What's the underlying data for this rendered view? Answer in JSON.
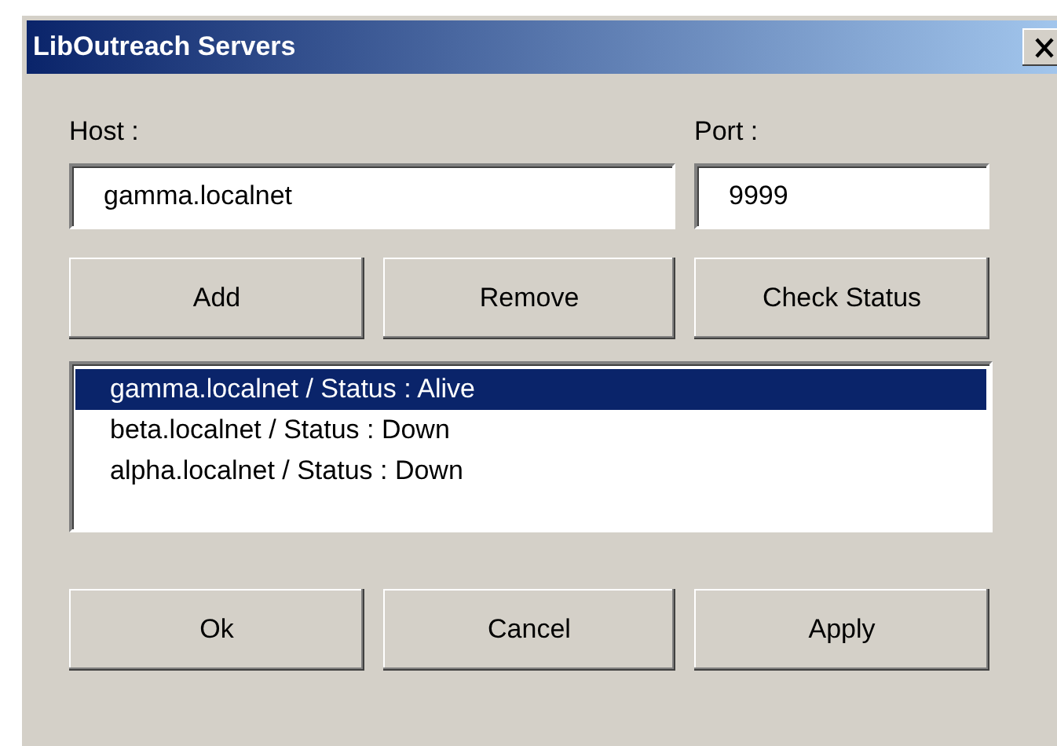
{
  "window": {
    "title": "LibOutreach Servers"
  },
  "host": {
    "label": "Host :",
    "value": "gamma.localnet"
  },
  "port": {
    "label": "Port :",
    "value": "9999"
  },
  "actions": [
    "Add",
    "Remove",
    "Check Status"
  ],
  "servers": [
    {
      "label": "gamma.localnet / Status : Alive",
      "selected": true
    },
    {
      "label": "beta.localnet / Status : Down",
      "selected": false
    },
    {
      "label": "alpha.localnet / Status : Down",
      "selected": false
    }
  ],
  "buttons": [
    "Ok",
    "Cancel",
    "Apply"
  ]
}
